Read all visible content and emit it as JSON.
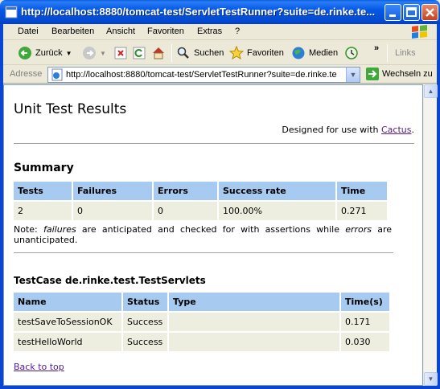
{
  "window": {
    "title": "http://localhost:8880/tomcat-test/ServletTestRunner?suite=de.rinke.te...",
    "minimize": "_",
    "maximize": "□",
    "close": "×"
  },
  "menu": [
    "Datei",
    "Bearbeiten",
    "Ansicht",
    "Favoriten",
    "Extras",
    "?"
  ],
  "toolbar": {
    "back": "Zurück",
    "search": "Suchen",
    "favorites": "Favoriten",
    "media": "Medien",
    "links": "Links"
  },
  "address": {
    "label": "Adresse",
    "url": "http://localhost:8880/tomcat-test/ServletTestRunner?suite=de.rinke.te",
    "go": "Wechseln zu"
  },
  "page": {
    "title": "Unit Test Results",
    "designed_prefix": "Designed for use with ",
    "designed_link": "Cactus",
    "designed_suffix": ".",
    "summary_heading": "Summary",
    "summary_headers": [
      "Tests",
      "Failures",
      "Errors",
      "Success rate",
      "Time"
    ],
    "summary_values": [
      "2",
      "0",
      "0",
      "100.00%",
      "0.271"
    ],
    "note_prefix": "Note: ",
    "note_failures": "failures",
    "note_middle": " are anticipated and checked for with assertions while ",
    "note_errors": "errors",
    "note_suffix": " are unanticipated.",
    "testcase_heading": "TestCase de.rinke.test.TestServlets",
    "testcase_headers": [
      "Name",
      "Status",
      "Type",
      "Time(s)"
    ],
    "testcase_rows": [
      [
        "testSaveToSessionOK",
        "Success",
        "",
        "0.171"
      ],
      [
        "testHelloWorld",
        "Success",
        "",
        "0.030"
      ]
    ],
    "back_to_top": "Back to top"
  },
  "colors": {
    "table_header": "#a6caf0",
    "table_cell": "#eeeee0",
    "link_visited": "#551a8b",
    "titlebar": "#0559e6"
  }
}
